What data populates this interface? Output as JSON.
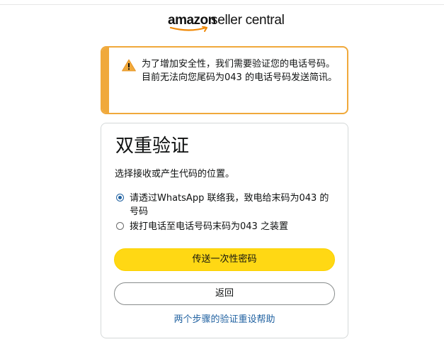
{
  "logo": {
    "brand": "amazon",
    "product": "seller central"
  },
  "alert": {
    "icon": "warning-triangle-icon",
    "color": "#f0a93b",
    "message": "为了增加安全性，我们需要验证您的电话号码。目前无法向您尾码为043 的电话号码发送简讯。"
  },
  "card": {
    "title": "双重验证",
    "subtitle": "选择接收或产生代码的位置。",
    "options": [
      {
        "label": "请透过WhatsApp 联络我，致电给末码为043 的号码",
        "selected": true
      },
      {
        "label": "拨打电话至电话号码末码为043 之装置",
        "selected": false
      }
    ],
    "primary_button": "传送一次性密码",
    "secondary_button": "返回",
    "help_link": "两个步骤的验证重设帮助"
  },
  "colors": {
    "primary_button": "#ffd814",
    "link": "#2162a1",
    "accent": "#f0a93b"
  }
}
